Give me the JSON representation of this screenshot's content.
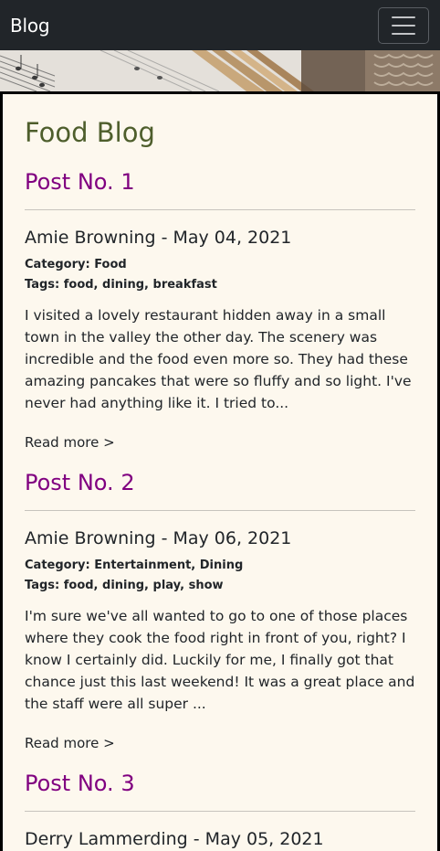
{
  "navbar": {
    "brand": "Blog",
    "toggler_icon": "hamburger-menu-icon"
  },
  "hero": {
    "image": "sheet-music-and-pencils-banner"
  },
  "main": {
    "title": "Food Blog",
    "posts": [
      {
        "title": "Post No. 1",
        "author_date": "Amie Browning - May 04, 2021",
        "category": "Category: Food",
        "tags": "Tags: food, dining, breakfast",
        "excerpt": "I visited a lovely restaurant hidden away in a small town in the valley the other day. The scenery was incredible and the food even more so. They had these amazing pancakes that were so fluffy and so light. I've never had anything like it. I tried to...",
        "read_more": "Read more >"
      },
      {
        "title": "Post No. 2",
        "author_date": "Amie Browning - May 06, 2021",
        "category": "Category: Entertainment, Dining",
        "tags": "Tags: food, dining, play, show",
        "excerpt": "I'm sure we've all wanted to go to one of those places where they cook the food right in front of you, right? I know I certainly did. Luckily for me, I finally got that chance just this last weekend! It was a great place and the staff were all super ...",
        "read_more": "Read more >"
      },
      {
        "title": "Post No. 3",
        "author_date": "Derry Lammerding - May 05, 2021"
      }
    ]
  },
  "colors": {
    "navbar_bg": "#212529",
    "page_bg": "#fdf8ee",
    "page_title": "#4e5e2c",
    "post_title": "#800080"
  }
}
